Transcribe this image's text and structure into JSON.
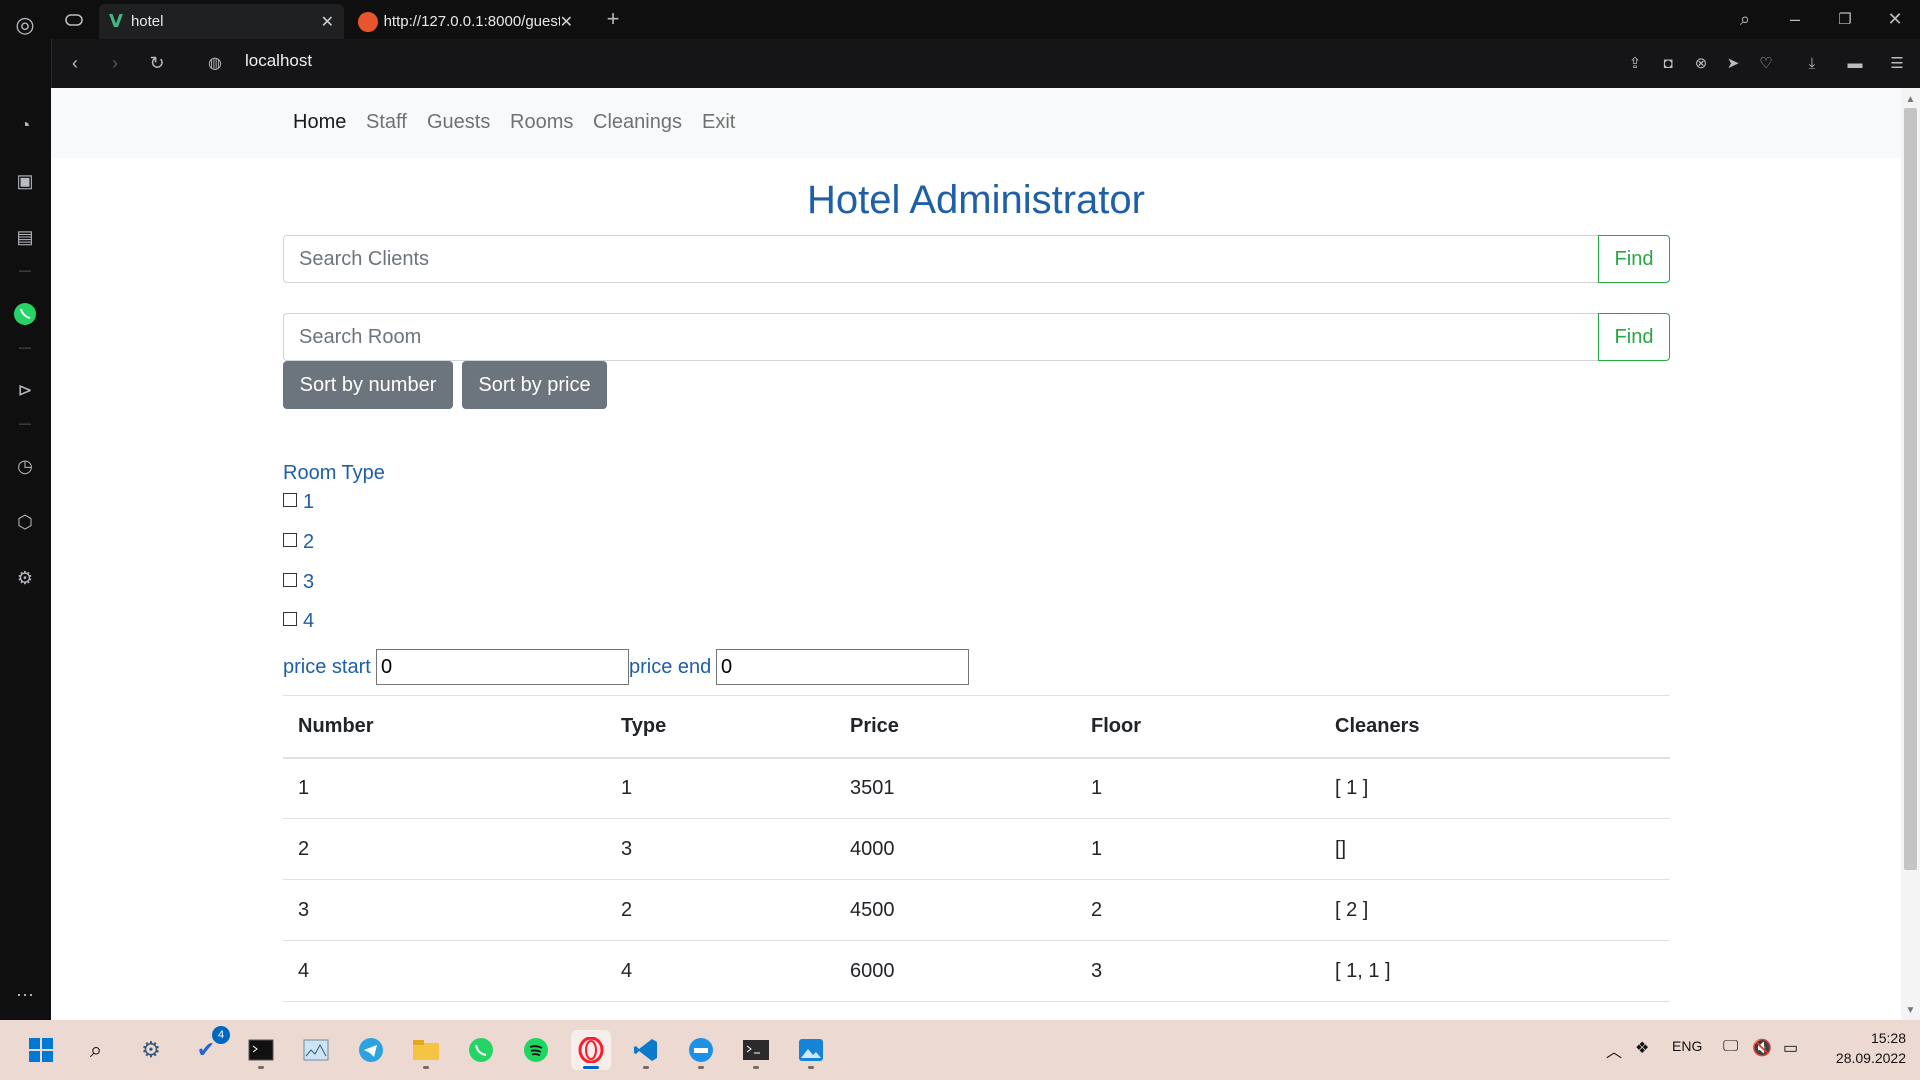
{
  "browser": {
    "tabs": [
      {
        "title": "hotel",
        "active": true,
        "icon": "vue-logo-icon"
      },
      {
        "title": "http://127.0.0.1:8000/guest",
        "active": false,
        "icon": "django-logo-icon"
      }
    ],
    "address": "localhost"
  },
  "nav": {
    "items": [
      "Home",
      "Staff",
      "Guests",
      "Rooms",
      "Cleanings",
      "Exit"
    ],
    "active": "Home"
  },
  "page": {
    "title": "Hotel Administrator",
    "search_clients": {
      "placeholder": "Search Clients",
      "button": "Find"
    },
    "search_room": {
      "placeholder": "Search Room",
      "button": "Find"
    },
    "sort_number_label": "Sort by number",
    "sort_price_label": "Sort by price",
    "room_type_label": "Room Type",
    "room_types": [
      "1",
      "2",
      "3",
      "4"
    ],
    "price_start_label": "price start",
    "price_start_value": "0",
    "price_end_label": "price end",
    "price_end_value": "0"
  },
  "table": {
    "headers": [
      "Number",
      "Type",
      "Price",
      "Floor",
      "Cleaners"
    ],
    "rows": [
      [
        "1",
        "1",
        "3501",
        "1",
        "[ 1 ]"
      ],
      [
        "2",
        "3",
        "4000",
        "1",
        "[]"
      ],
      [
        "3",
        "2",
        "4500",
        "2",
        "[ 2 ]"
      ],
      [
        "4",
        "4",
        "6000",
        "3",
        "[ 1, 1 ]"
      ]
    ]
  },
  "taskbar": {
    "todo_badge": "4",
    "language": "ENG",
    "time": "15:28",
    "date": "28.09.2022"
  },
  "colors": {
    "title_blue": "#1e5fa8",
    "find_green": "#28a745",
    "sort_gray": "#6c757d",
    "taskbar_bg": "#ecdad2"
  }
}
